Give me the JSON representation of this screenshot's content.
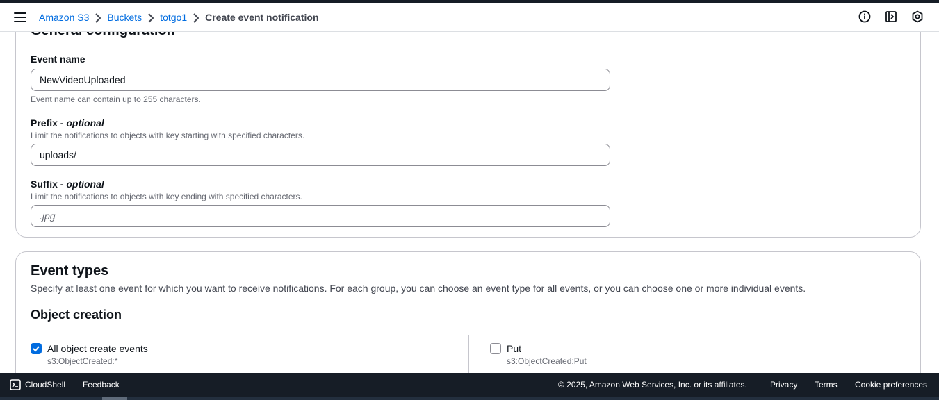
{
  "breadcrumb": {
    "items": [
      "Amazon S3",
      "Buckets",
      "totgo1"
    ],
    "current": "Create event notification"
  },
  "general": {
    "title": "General configuration",
    "event_name": {
      "label": "Event name",
      "value": "NewVideoUploaded",
      "description": "Event name can contain up to 255 characters."
    },
    "prefix": {
      "label": "Prefix - ",
      "label_suffix": "optional",
      "description": "Limit the notifications to objects with key starting with specified characters.",
      "value": "uploads/"
    },
    "suffix": {
      "label": "Suffix - ",
      "label_suffix": "optional",
      "description": "Limit the notifications to objects with key ending with specified characters.",
      "placeholder": ".jpg"
    }
  },
  "event_types": {
    "title": "Event types",
    "description": "Specify at least one event for which you want to receive notifications. For each group, you can choose an event type for all events, or you can choose one or more individual events.",
    "object_creation": {
      "title": "Object creation",
      "options": [
        {
          "label": "All object create events",
          "sub": "s3:ObjectCreated:*",
          "checked": true
        },
        {
          "label": "Put",
          "sub": "s3:ObjectCreated:Put",
          "checked": false
        }
      ]
    }
  },
  "footer": {
    "cloudshell": "CloudShell",
    "feedback": "Feedback",
    "copyright": "© 2025, Amazon Web Services, Inc. or its affiliates.",
    "privacy": "Privacy",
    "terms": "Terms",
    "cookies": "Cookie preferences"
  },
  "colors": {
    "link": "#006ce0",
    "footer_bg": "#161d26",
    "checkbox_checked": "#006ce0"
  },
  "icons": [
    "menu-icon",
    "chevron-right-icon",
    "info-icon",
    "notifications-panel-icon",
    "security-settings-icon",
    "cloudshell-icon",
    "checkmark-icon"
  ]
}
